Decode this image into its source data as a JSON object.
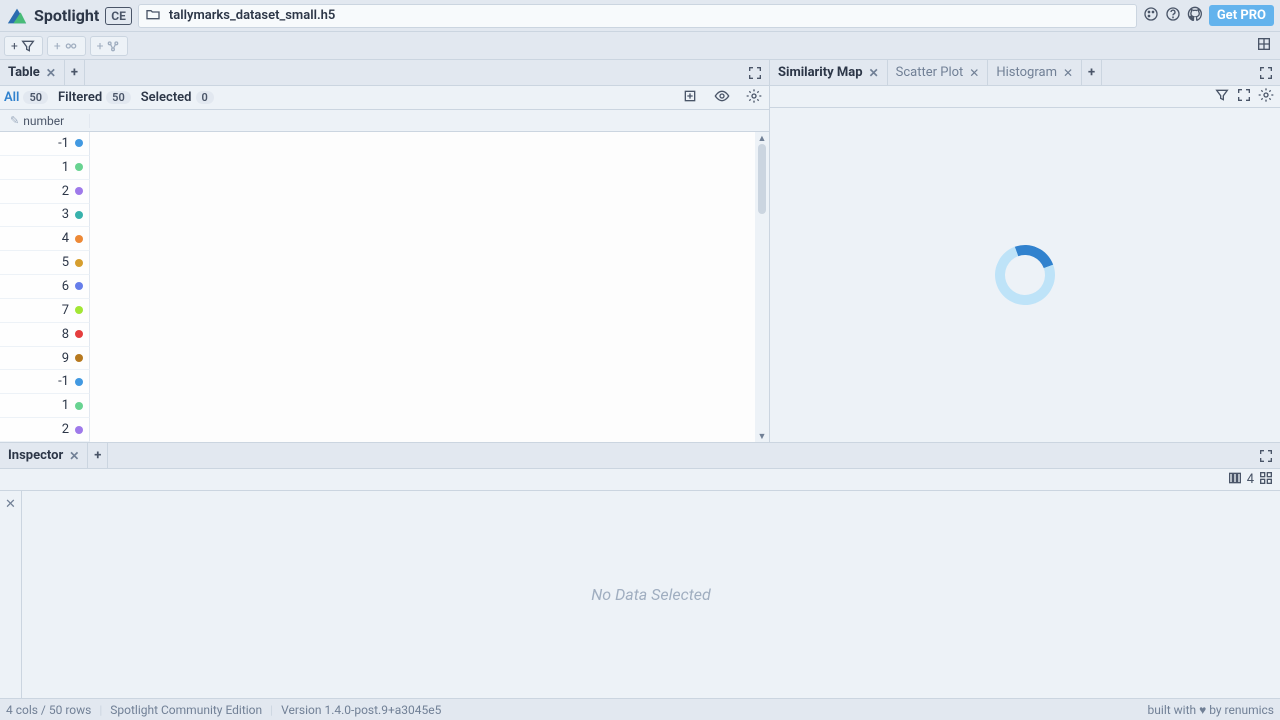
{
  "header": {
    "brand": "Spotlight",
    "edition": "CE",
    "filename": "tallymarks_dataset_small.h5",
    "get_pro": "Get PRO"
  },
  "left": {
    "tab_label": "Table",
    "subbar": {
      "all_label": "All",
      "all_count": "50",
      "filtered_label": "Filtered",
      "filtered_count": "50",
      "selected_label": "Selected",
      "selected_count": "0"
    },
    "column_header": "number",
    "rows": [
      {
        "value": "-1",
        "color": "#4299e1"
      },
      {
        "value": "1",
        "color": "#68d391"
      },
      {
        "value": "2",
        "color": "#9f7aea"
      },
      {
        "value": "3",
        "color": "#38b2ac"
      },
      {
        "value": "4",
        "color": "#ed8936"
      },
      {
        "value": "5",
        "color": "#d69e2e"
      },
      {
        "value": "6",
        "color": "#667eea"
      },
      {
        "value": "7",
        "color": "#a3e635"
      },
      {
        "value": "8",
        "color": "#e53e3e"
      },
      {
        "value": "9",
        "color": "#b7791f"
      },
      {
        "value": "-1",
        "color": "#4299e1"
      },
      {
        "value": "1",
        "color": "#68d391"
      },
      {
        "value": "2",
        "color": "#9f7aea"
      }
    ]
  },
  "right": {
    "tabs": [
      {
        "label": "Similarity Map",
        "active": true
      },
      {
        "label": "Scatter Plot",
        "active": false
      },
      {
        "label": "Histogram",
        "active": false
      }
    ]
  },
  "inspector": {
    "tab_label": "Inspector",
    "columns_badge": "4",
    "empty_message": "No Data Selected"
  },
  "status": {
    "shape": "4 cols / 50 rows",
    "edition_full": "Spotlight Community Edition",
    "version": "Version 1.4.0-post.9+a3045e5",
    "credit_prefix": "built with ",
    "credit_suffix": " by renumics"
  }
}
